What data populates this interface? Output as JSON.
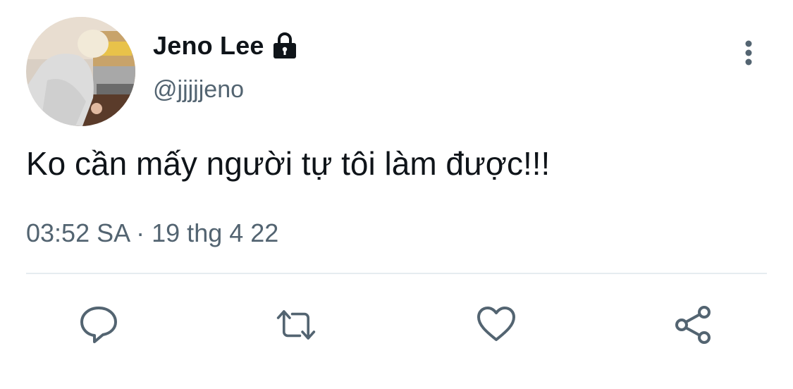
{
  "tweet": {
    "display_name": "Jeno Lee",
    "handle": "@jjjjjeno",
    "text": "Ko cần mấy người tự tôi làm được!!!",
    "time": "03:52 SA",
    "separator": " · ",
    "date": "19 thg 4 22",
    "protected": true
  },
  "icons": {
    "lock": "lock-icon",
    "more": "more-vertical-icon",
    "reply": "reply-icon",
    "retweet": "retweet-icon",
    "like": "heart-icon",
    "share": "share-icon"
  },
  "colors": {
    "text_primary": "#0f1419",
    "text_secondary": "#536471",
    "divider": "#e6ecf0",
    "icon": "#536471"
  }
}
